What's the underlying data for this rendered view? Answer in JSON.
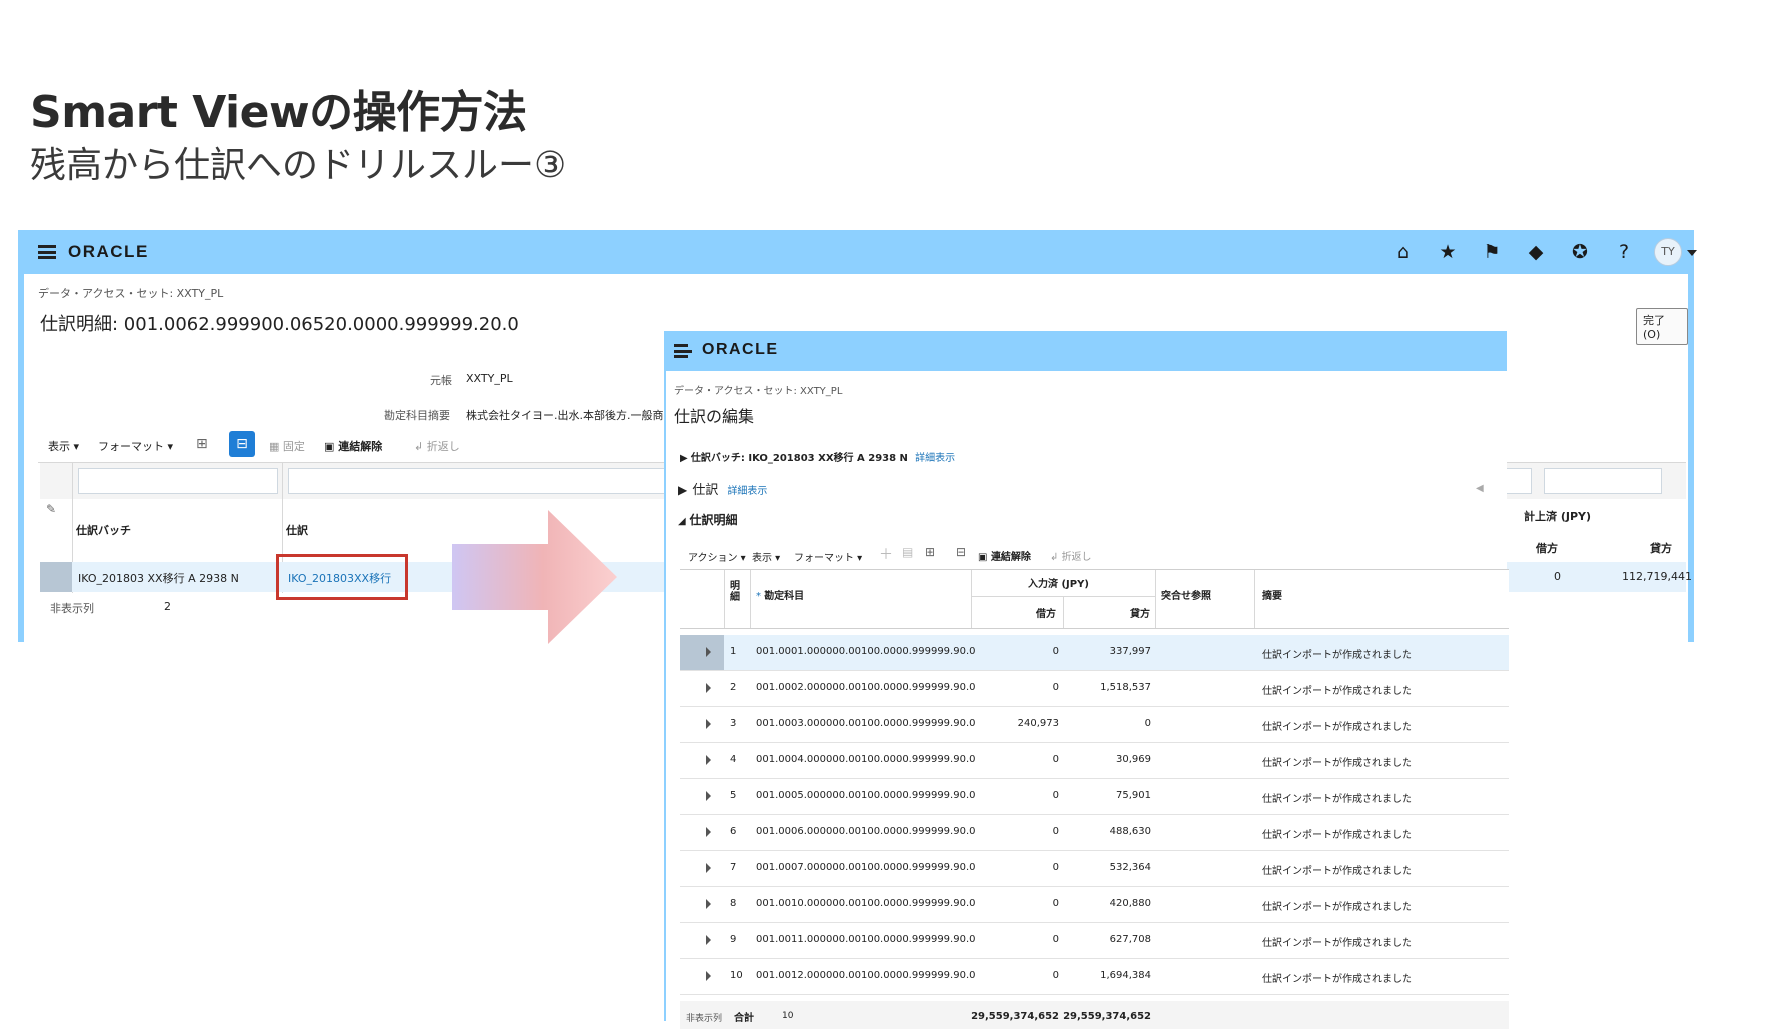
{
  "slide": {
    "title": "Smart Viewの操作方法",
    "subtitle": "残高から仕訳へのドリルスルー③"
  },
  "back_window": {
    "logo": "ORACLE",
    "avatar_initials": "TY",
    "data_access_set": "データ・アクセス・セット: XXTY_PL",
    "page_title": "仕訳明細: 001.0062.999900.06520.0000.999999.20.0",
    "done_button": "完了(O)",
    "ledger_label": "元帳",
    "ledger_value": "XXTY_PL",
    "account_desc_label": "勘定科目摘要",
    "account_desc_value": "株式会社タイヨー.出水.本部後方.一般商",
    "toolbar": {
      "view": "表示",
      "format": "フォーマット",
      "freeze": "固定",
      "detach": "連結解除",
      "wrap": "折返し"
    },
    "columns": {
      "batch": "仕訳バッチ",
      "journal": "仕訳",
      "posted": "計上済 (JPY)",
      "debit": "借方",
      "credit": "貸方"
    },
    "row": {
      "batch": "IKO_201803 XX移行 A 2938 N",
      "journal": "IKO_201803XX移行",
      "debit": "0",
      "credit": "112,719,441"
    },
    "hidden_cols_label": "非表示列",
    "hidden_cols_value": "2"
  },
  "front_window": {
    "logo": "ORACLE",
    "data_access_set": "データ・アクセス・セット: XXTY_PL",
    "page_title": "仕訳の編集",
    "batch_section": "仕訳バッチ: IKO_201803 XX移行 A 2938 N",
    "journal_section": "仕訳",
    "detail_link": "詳細表示",
    "lines_section": "仕訳明細",
    "toolbar": {
      "action": "アクション",
      "view": "表示",
      "format": "フォーマット",
      "detach": "連結解除",
      "wrap": "折返し"
    },
    "columns": {
      "line": "明細",
      "required_mark": "*",
      "account": "勘定科目",
      "entered": "入力済 (JPY)",
      "debit": "借方",
      "credit": "貸方",
      "reconcile": "突合せ参照",
      "description": "摘要"
    },
    "rows": [
      {
        "no": "1",
        "account": "001.0001.000000.00100.0000.999999.90.0",
        "debit": "0",
        "credit": "337,997",
        "desc": "仕訳インポートが作成されました"
      },
      {
        "no": "2",
        "account": "001.0002.000000.00100.0000.999999.90.0",
        "debit": "0",
        "credit": "1,518,537",
        "desc": "仕訳インポートが作成されました"
      },
      {
        "no": "3",
        "account": "001.0003.000000.00100.0000.999999.90.0",
        "debit": "240,973",
        "credit": "0",
        "desc": "仕訳インポートが作成されました"
      },
      {
        "no": "4",
        "account": "001.0004.000000.00100.0000.999999.90.0",
        "debit": "0",
        "credit": "30,969",
        "desc": "仕訳インポートが作成されました"
      },
      {
        "no": "5",
        "account": "001.0005.000000.00100.0000.999999.90.0",
        "debit": "0",
        "credit": "75,901",
        "desc": "仕訳インポートが作成されました"
      },
      {
        "no": "6",
        "account": "001.0006.000000.00100.0000.999999.90.0",
        "debit": "0",
        "credit": "488,630",
        "desc": "仕訳インポートが作成されました"
      },
      {
        "no": "7",
        "account": "001.0007.000000.00100.0000.999999.90.0",
        "debit": "0",
        "credit": "532,364",
        "desc": "仕訳インポートが作成されました"
      },
      {
        "no": "8",
        "account": "001.0010.000000.00100.0000.999999.90.0",
        "debit": "0",
        "credit": "420,880",
        "desc": "仕訳インポートが作成されました"
      },
      {
        "no": "9",
        "account": "001.0011.000000.00100.0000.999999.90.0",
        "debit": "0",
        "credit": "627,708",
        "desc": "仕訳インポートが作成されました"
      },
      {
        "no": "10",
        "account": "001.0012.000000.00100.0000.999999.90.0",
        "debit": "0",
        "credit": "1,694,384",
        "desc": "仕訳インポートが作成されました"
      }
    ],
    "total_label": "合計",
    "total_debit": "29,559,374,652",
    "total_credit": "29,559,374,652",
    "hidden_cols_label": "非表示列",
    "hidden_cols_value": "10"
  }
}
